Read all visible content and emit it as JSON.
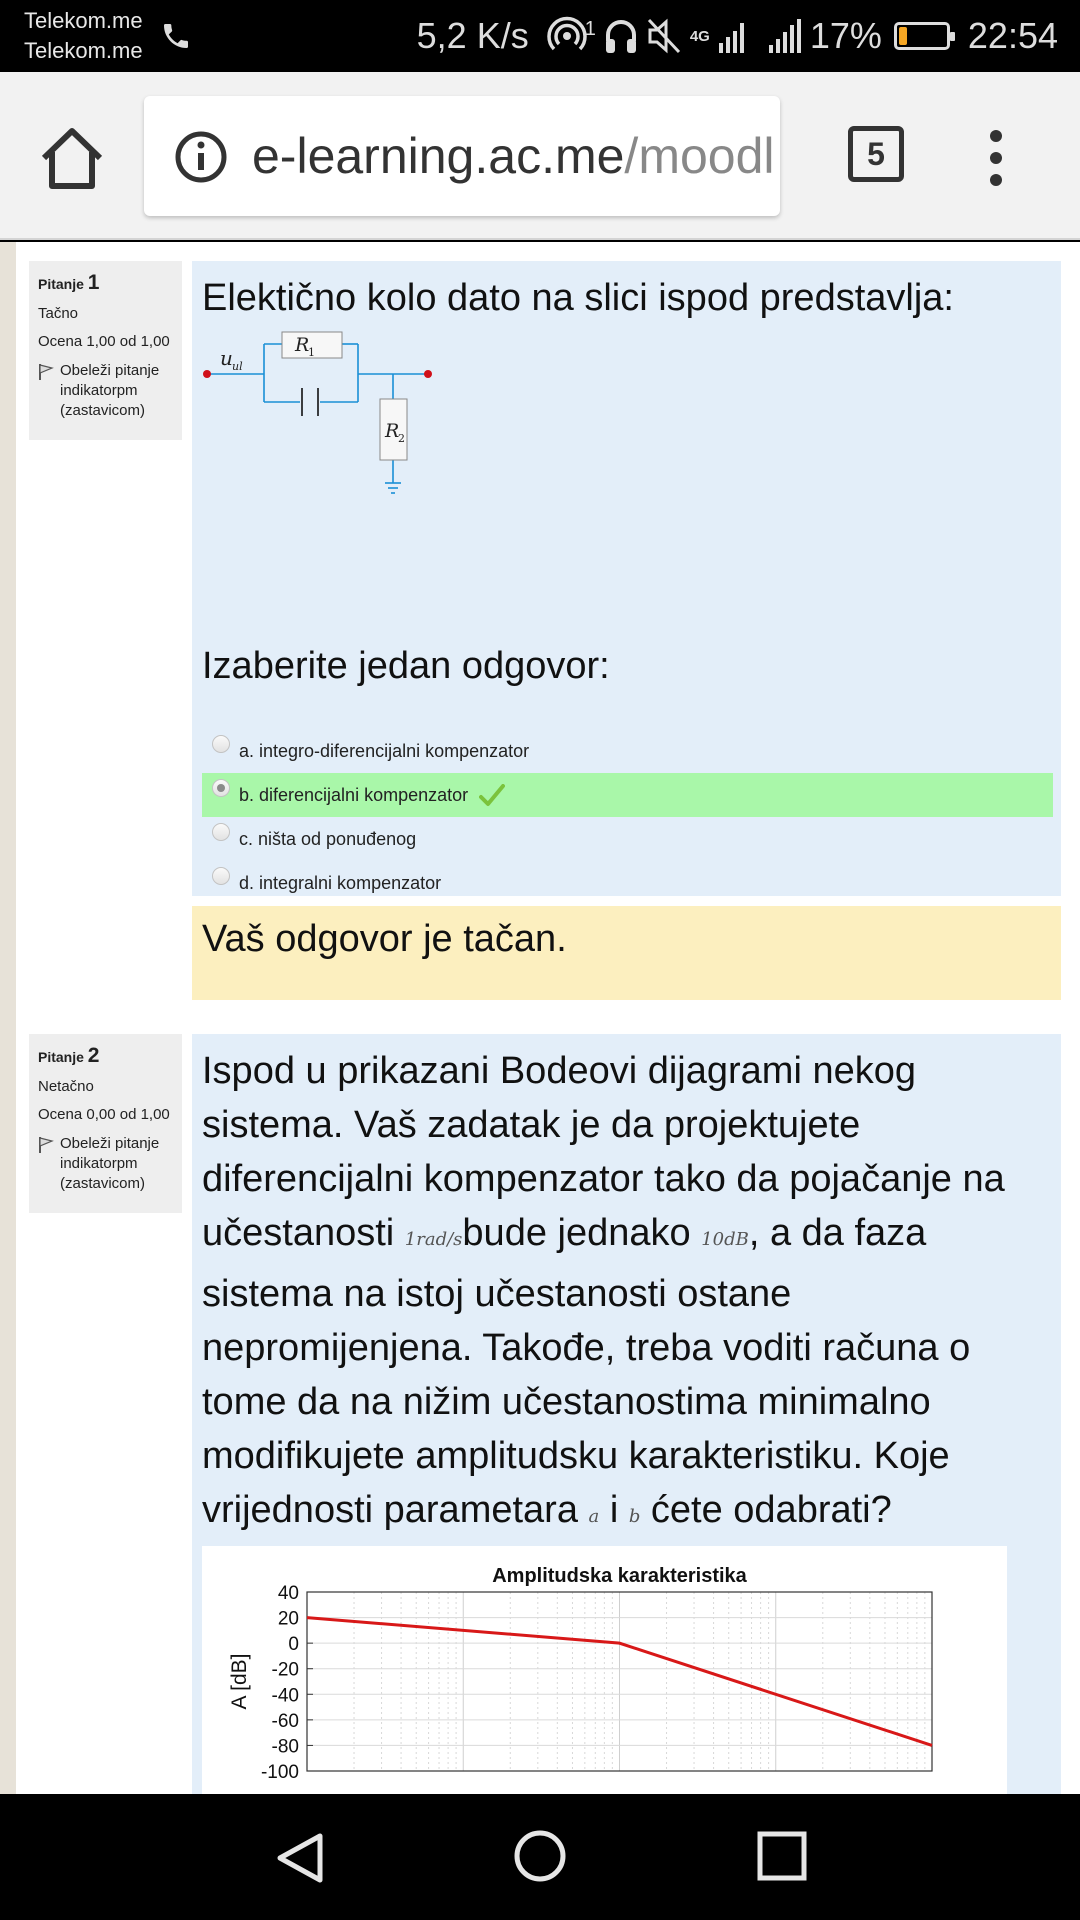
{
  "status_bar": {
    "carrier_line1": "Telekom.me",
    "carrier_line2": "Telekom.me",
    "speed": "5,2 K/s",
    "hotspot_count": "1",
    "network": "4G",
    "battery": "17%",
    "battery_level": 0.17,
    "time": "22:54"
  },
  "browser": {
    "url_host": "e-learning.ac.me",
    "url_path": "/moodl",
    "tab_count": "5"
  },
  "question1": {
    "label": "Pitanje",
    "number": "1",
    "state": "Tačno",
    "grade": "Ocena 1,00 od 1,00",
    "flag": "Obeleži pitanje indikatorpm (zastavicom)",
    "text": "Elektično kolo dato na slici ispod predstavlja:",
    "circuit": {
      "input": "u",
      "input_sub": "ul",
      "r1": "R",
      "r1_sub": "1",
      "r2": "R",
      "r2_sub": "2"
    },
    "prompt": "Izaberite jedan odgovor:",
    "answers": [
      {
        "label": "a. integro-diferencijalni kompenzator",
        "selected": false
      },
      {
        "label": "b. diferencijalni kompenzator",
        "selected": true,
        "correct": true
      },
      {
        "label": "c. ništa od ponuđenog",
        "selected": false
      },
      {
        "label": "d. integralni kompenzator",
        "selected": false
      }
    ],
    "feedback": "Vaš odgovor je tačan."
  },
  "question2": {
    "label": "Pitanje",
    "number": "2",
    "state": "Netačno",
    "grade": "Ocena 0,00 od 1,00",
    "flag": "Obeleži pitanje indikatorpm (zastavicom)",
    "text_part1": "Ispod u prikazani Bodeovi dijagrami nekog sistema. Vaš zadatak je da projektujete diferencijalni kompenzator tako da pojačanje na učestanosti ",
    "math1": "1rad/s",
    "text_part2": "bude jednako ",
    "math2": "10dB",
    "text_part3": ", a da faza sistema na istoj učestanosti ostane nepromijenjena. Takođe, treba voditi računa o tome da na nižim učestanostima minimalno modifikujete amplitudsku karakteristiku. Koje vrijednosti parametara ",
    "math3": "a",
    "text_part4": "i ",
    "math4": "b",
    "text_part5": "ćete odabrati?"
  },
  "chart_data": {
    "type": "line",
    "title": "Amplitudska karakteristika",
    "ylabel": "A [dB]",
    "xlabel": "",
    "xscale": "log",
    "xlim": [
      0.01,
      100
    ],
    "ylim": [
      -100,
      40
    ],
    "yticks": [
      "40",
      "20",
      "0",
      "-20",
      "-40",
      "-60",
      "-80",
      "-100"
    ],
    "grid": true,
    "series": [
      {
        "color": "#d81818",
        "x": [
          0.01,
          1,
          100
        ],
        "y": [
          20,
          0,
          -80
        ]
      }
    ]
  }
}
